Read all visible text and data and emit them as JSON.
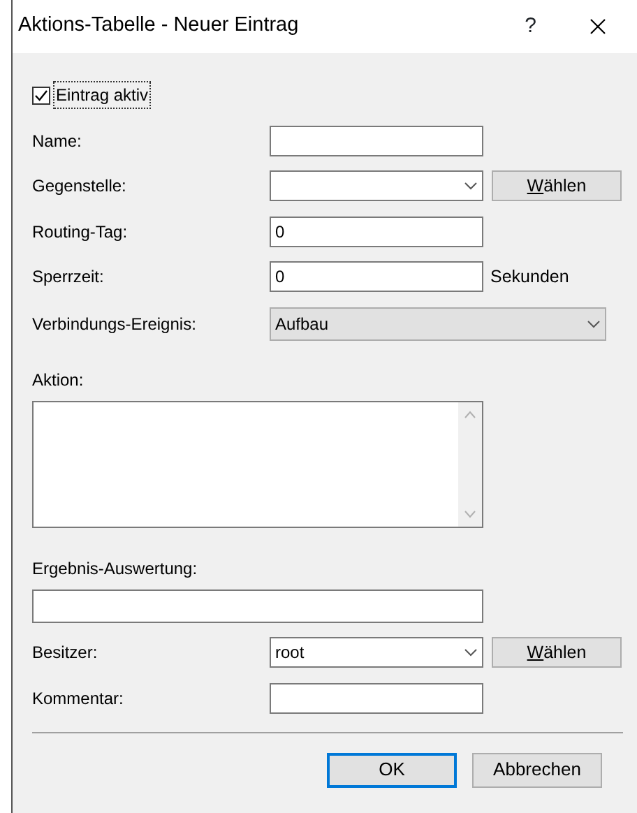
{
  "window": {
    "title": "Aktions-Tabelle - Neuer Eintrag",
    "help": "?"
  },
  "rows": [
    {
      "kind": "checkbox",
      "label": "Eintrag aktiv",
      "checked": true,
      "focused": true
    },
    {
      "kind": "text",
      "label": "Name:"
    },
    {
      "kind": "combo",
      "label": "Gegenstelle:",
      "button": "Wählen"
    },
    {
      "kind": "text",
      "label": "Routing-Tag:",
      "value": "0"
    },
    {
      "kind": "text",
      "label": "Sperrzeit:",
      "value": "0",
      "unit": "Sekunden"
    },
    {
      "kind": "select",
      "label": "Verbindungs-Ereignis:",
      "value": "Aufbau"
    },
    {
      "kind": "textarea",
      "label": "Aktion:"
    },
    {
      "kind": "wide",
      "label": "Ergebnis-Auswertung:"
    },
    {
      "kind": "combo",
      "label": "Besitzer:",
      "value": "root",
      "button": "Wählen"
    },
    {
      "kind": "text",
      "label": "Kommentar:"
    }
  ],
  "buttons": [
    {
      "label": "OK",
      "default": true
    },
    {
      "label": "Abbrechen",
      "default": false
    }
  ]
}
